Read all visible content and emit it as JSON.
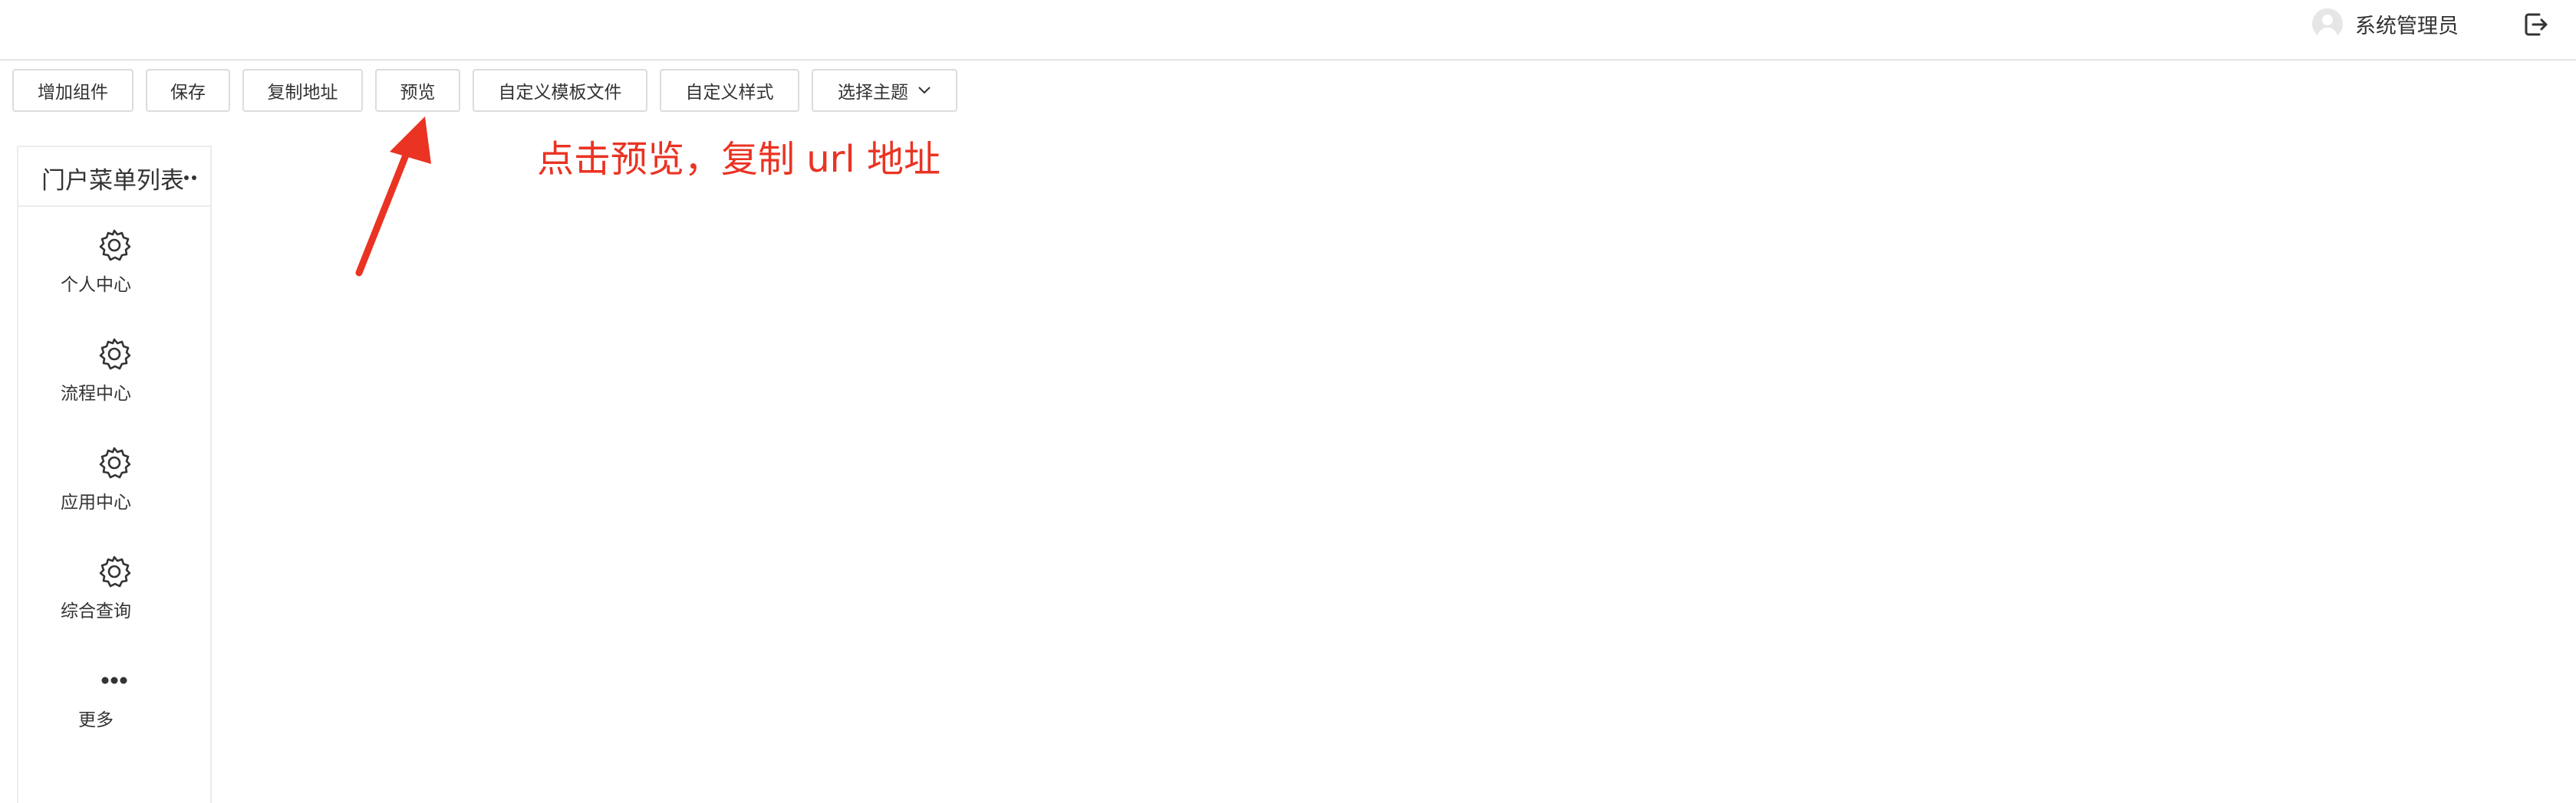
{
  "header": {
    "user_name": "系统管理员",
    "icons": {
      "avatar": "user-avatar-icon",
      "logout": "logout-icon"
    }
  },
  "toolbar": {
    "buttons": [
      {
        "label": "增加组件"
      },
      {
        "label": "保存"
      },
      {
        "label": "复制地址"
      },
      {
        "label": "预览"
      },
      {
        "label": "自定义模板文件"
      },
      {
        "label": "自定义样式"
      },
      {
        "label": "选择主题"
      }
    ]
  },
  "annotation": {
    "text": "点击预览，复制 url 地址",
    "color": "#ea3323"
  },
  "sidebar": {
    "title": "门户菜单列表",
    "items": [
      {
        "label": "个人中心",
        "icon": "gear-icon"
      },
      {
        "label": "流程中心",
        "icon": "gear-icon"
      },
      {
        "label": "应用中心",
        "icon": "gear-icon"
      },
      {
        "label": "综合查询",
        "icon": "gear-icon"
      },
      {
        "label": "更多",
        "icon": "more-dots-icon"
      }
    ]
  }
}
